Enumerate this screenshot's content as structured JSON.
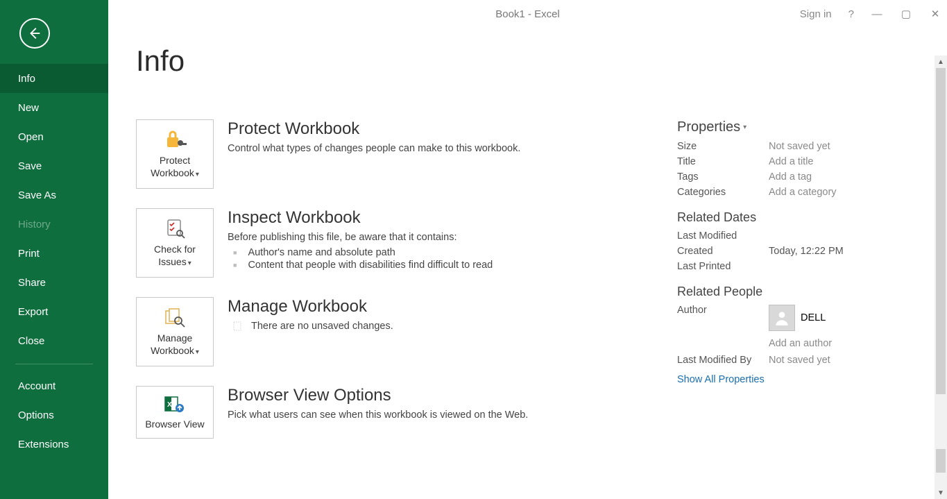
{
  "titlebar": {
    "doc_title": "Book1  -  Excel",
    "sign_in": "Sign in",
    "help": "?"
  },
  "sidebar": {
    "items": [
      {
        "label": "Info",
        "selected": true
      },
      {
        "label": "New"
      },
      {
        "label": "Open"
      },
      {
        "label": "Save"
      },
      {
        "label": "Save As"
      },
      {
        "label": "History",
        "disabled": true
      },
      {
        "label": "Print"
      },
      {
        "label": "Share"
      },
      {
        "label": "Export"
      },
      {
        "label": "Close"
      }
    ],
    "bottom_items": [
      {
        "label": "Account"
      },
      {
        "label": "Options"
      },
      {
        "label": "Extensions"
      }
    ]
  },
  "page": {
    "title": "Info"
  },
  "sections": {
    "protect": {
      "tile_line1": "Protect",
      "tile_line2": "Workbook",
      "title": "Protect Workbook",
      "desc": "Control what types of changes people can make to this workbook."
    },
    "inspect": {
      "tile_line1": "Check for",
      "tile_line2": "Issues",
      "title": "Inspect Workbook",
      "desc": "Before publishing this file, be aware that it contains:",
      "bullets": [
        "Author's name and absolute path",
        "Content that people with disabilities find difficult to read"
      ]
    },
    "manage": {
      "tile_line1": "Manage",
      "tile_line2": "Workbook",
      "title": "Manage Workbook",
      "desc": "There are no unsaved changes."
    },
    "browser": {
      "tile_line1": "Browser View",
      "title": "Browser View Options",
      "desc": "Pick what users can see when this workbook is viewed on the Web."
    }
  },
  "properties": {
    "header": "Properties",
    "rows": {
      "size": {
        "label": "Size",
        "value": "Not saved yet"
      },
      "title": {
        "label": "Title",
        "value": "Add a title"
      },
      "tags": {
        "label": "Tags",
        "value": "Add a tag"
      },
      "categories": {
        "label": "Categories",
        "value": "Add a category"
      }
    },
    "dates": {
      "header": "Related Dates",
      "last_modified": {
        "label": "Last Modified",
        "value": ""
      },
      "created": {
        "label": "Created",
        "value": "Today, 12:22 PM"
      },
      "last_printed": {
        "label": "Last Printed",
        "value": ""
      }
    },
    "people": {
      "header": "Related People",
      "author_label": "Author",
      "author_name": "DELL",
      "add_author": "Add an author",
      "last_modified_by_label": "Last Modified By",
      "last_modified_by_value": "Not saved yet"
    },
    "show_all": "Show All Properties"
  }
}
